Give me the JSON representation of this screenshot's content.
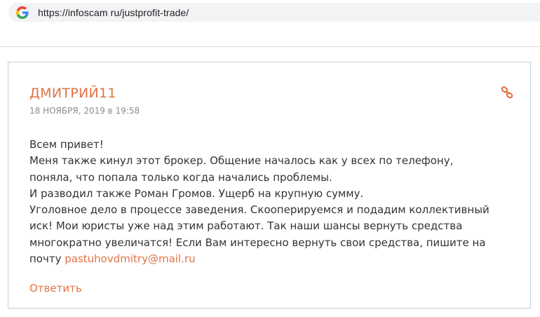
{
  "browser": {
    "url": "https://infoscam ru/justprofit-trade/",
    "favicon": "google-g-icon"
  },
  "comment": {
    "author": "ДМИТРИЙ11",
    "date": "18 НОЯБРЯ, 2019 в 19:58",
    "permalink_icon": "link-icon",
    "lines": [
      "Всем привет!",
      "Меня также кинул этот брокер. Общение началось как у всех по телефону,",
      "поняла, что попала только когда начались проблемы.",
      "И разводил также Роман Громов. Ущерб на крупную сумму.",
      "Уголовное дело в процессе заведения. Скооперируемся и подадим коллективный",
      "иск! Мои юристы уже над этим работают. Так наши шансы вернуть средства",
      "многократно увеличатся! Если Вам интересно вернуть свои средства, пишите на"
    ],
    "last_line_prefix": "почту",
    "email": "pastuhovdmitry@mail.ru",
    "reply_label": "Ответить"
  },
  "colors": {
    "accent": "#e07446",
    "date_gray": "#8a8a8a",
    "text": "#333333",
    "border": "#c8cfd6",
    "urlbar_bg": "#f1f3f4"
  }
}
